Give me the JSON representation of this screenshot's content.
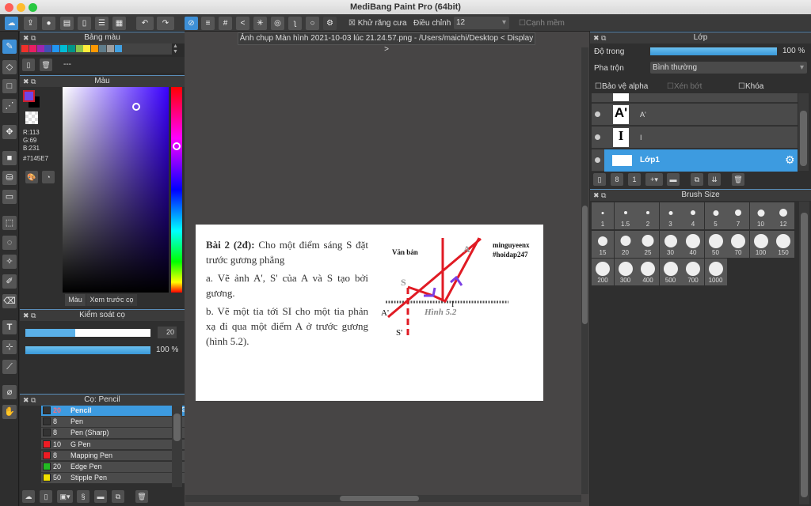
{
  "window": {
    "title": "MediBang Paint Pro (64bit)"
  },
  "toolbar": {
    "antialias_label": "Khử răng cưa",
    "antialias_checked": true,
    "adjust_label": "Điều chỉnh",
    "adjust_value": "12",
    "smooth_edge_label": "Cạnh mềm",
    "smooth_edge_checked": false
  },
  "document": {
    "tab_title": "Ảnh chụp Màn hình 2021-10-03 lúc 21.24.57.png - /Users/maichi/Desktop < Display >",
    "heading": "Bài 2 (2đ):",
    "line1": " Cho một điểm sáng S đặt trước gương phẳng",
    "line_a": "a. Vẽ ảnh A', S' của A và S tạo bởi gương.",
    "line_b": "b. Vẽ một tia tới SI cho một tia phản xạ đi qua một điểm A ở trước gương (hình 5.2).",
    "fig_label": "Văn bản",
    "watermark1": "minguyeenx",
    "watermark2": "#hoidap247",
    "fig_caption": "Hình 5.2",
    "pt_S": "S",
    "pt_A": "A",
    "pt_Aprime": "A'",
    "pt_Sprime": "S'",
    "pt_I": "I"
  },
  "palette_panel": {
    "title": "Bảng màu",
    "name": "---",
    "swatches": [
      "#f0302a",
      "#e91e63",
      "#9c27b0",
      "#3f51b5",
      "#2196f3",
      "#00bcd4",
      "#009688",
      "#8bc34a",
      "#ffeb3b",
      "#ff9800",
      "#607d8b",
      "#9e9e9e",
      "#42a0e0"
    ]
  },
  "color_panel": {
    "title": "Màu",
    "r": "R:113",
    "g": "G:69",
    "b": "B:231",
    "hex": "#7145E7",
    "tab_color": "Màu",
    "tab_preview": "Xem trước cọ"
  },
  "brush_control": {
    "title": "Kiểm soát cọ",
    "size": "20",
    "opacity": "100 %",
    "size_fraction": 0.4,
    "opacity_fraction": 1.0
  },
  "brush_panel": {
    "title": "Cọ: Pencil",
    "items": [
      {
        "size": "20",
        "name": "Pencil",
        "color": "#333333",
        "selected": true
      },
      {
        "size": "8",
        "name": "Pen",
        "color": "#333333"
      },
      {
        "size": "8",
        "name": "Pen (Sharp)",
        "color": "#333333"
      },
      {
        "size": "10",
        "name": "G Pen",
        "color": "#ee1c24"
      },
      {
        "size": "8",
        "name": "Mapping Pen",
        "color": "#ee1c24"
      },
      {
        "size": "20",
        "name": "Edge Pen",
        "color": "#22bb22"
      },
      {
        "size": "50",
        "name": "Stipple Pen",
        "color": "#f0e000"
      }
    ]
  },
  "layer_panel": {
    "title": "Lớp",
    "opacity_label": "Độ trong",
    "opacity_value": "100 %",
    "blend_label": "Pha trộn",
    "blend_value": "Bình thường",
    "protect_alpha": "Bảo vệ alpha",
    "clipping": "Xén bớt",
    "lock": "Khóa",
    "layers": [
      {
        "name": "A'",
        "thumb": "A'"
      },
      {
        "name": "I",
        "thumb": "I"
      },
      {
        "name": "Lớp1",
        "selected": true
      }
    ]
  },
  "brush_size_panel": {
    "title": "Brush Size",
    "sizes": [
      "1",
      "1.5",
      "2",
      "3",
      "4",
      "5",
      "7",
      "10",
      "12",
      "15",
      "20",
      "25",
      "30",
      "40",
      "50",
      "70",
      "100",
      "150",
      "200",
      "300",
      "400",
      "500",
      "700",
      "1000"
    ]
  }
}
